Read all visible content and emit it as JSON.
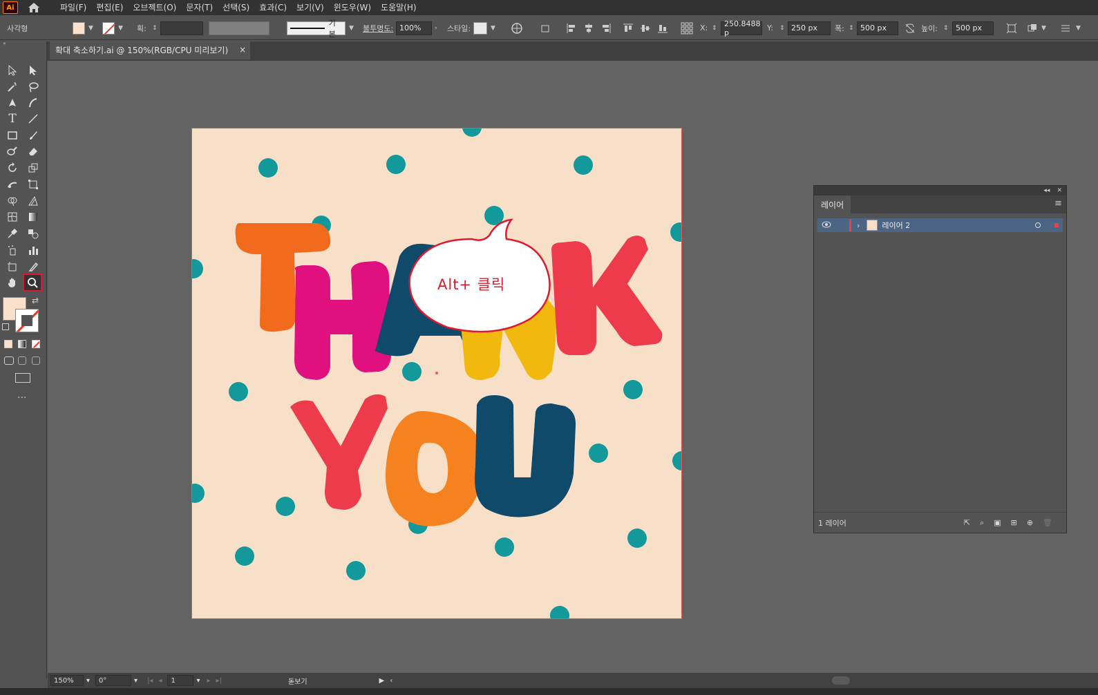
{
  "app": {
    "logo_text": "Ai",
    "menu": [
      "파일(F)",
      "편집(E)",
      "오브젝트(O)",
      "문자(T)",
      "선택(S)",
      "효과(C)",
      "보기(V)",
      "윈도우(W)",
      "도움말(H)"
    ]
  },
  "control_bar": {
    "selection_label": "사각형",
    "stroke_label": "획:",
    "stroke_style": "기본",
    "opacity_label": "불투명도:",
    "opacity_value": "100%",
    "style_label": "스타일:",
    "x_label": "X:",
    "x_value": "250.8488 p",
    "y_label": "Y:",
    "y_value": "250 px",
    "w_label": "폭:",
    "w_value": "500 px",
    "h_label": "높이:",
    "h_value": "500 px"
  },
  "document": {
    "tab_title": "확대 축소하기.ai @ 150%(RGB/CPU 미리보기)",
    "close_label": "×"
  },
  "artwork": {
    "callout_text": "Alt+ 클릭",
    "letters_top": [
      "T",
      "H",
      "A",
      "N",
      "K"
    ],
    "letters_bottom": [
      "Y",
      "O",
      "U"
    ],
    "colors": {
      "background": "#f8dfc8",
      "dots": "#13999b",
      "orange": "#f26a1b",
      "magenta": "#e0117f",
      "navy": "#0f4a6b",
      "yellow": "#f1b80e",
      "red": "#ee3b4c",
      "orange2": "#f5821f",
      "callout_stroke": "#e0182d"
    }
  },
  "layers_panel": {
    "tab_label": "레이어",
    "layer_name": "레이어 2",
    "count_label": "1 레이어"
  },
  "status_bar": {
    "zoom": "150%",
    "rotation": "0°",
    "page": "1",
    "tool_name": "돋보기"
  },
  "icons": [
    "home-icon",
    "zoom-tool-icon",
    "eye-icon",
    "trash-icon"
  ]
}
